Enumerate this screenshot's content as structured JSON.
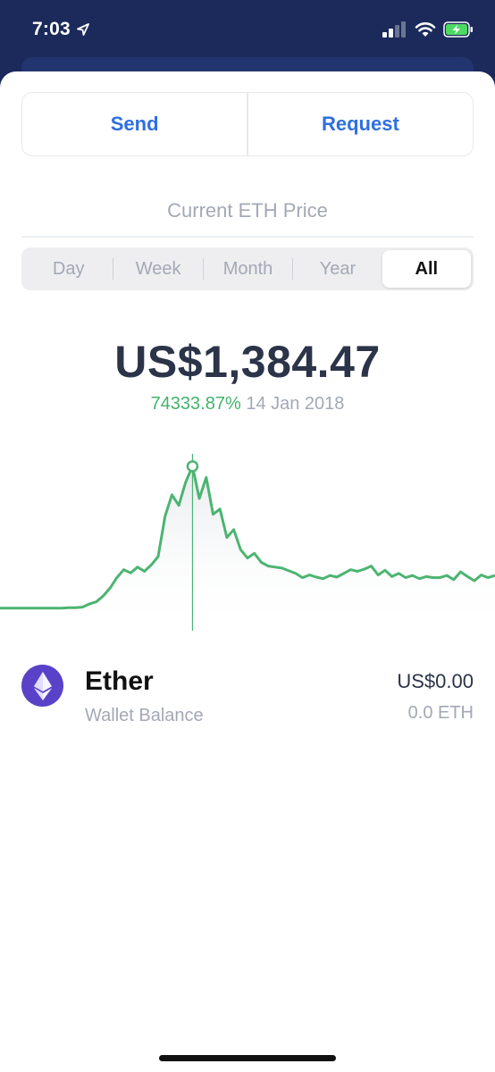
{
  "status_bar": {
    "time": "7:03",
    "icons": [
      "location-arrow-icon",
      "signal-icon",
      "wifi-icon",
      "battery-charging-icon"
    ]
  },
  "actions": {
    "send_label": "Send",
    "request_label": "Request"
  },
  "price_section": {
    "label": "Current ETH Price",
    "tabs": [
      "Day",
      "Week",
      "Month",
      "Year",
      "All"
    ],
    "active_tab": "All",
    "price": "US$1,384.47",
    "change_pct": "74333.87%",
    "date": "14 Jan 2018"
  },
  "chart_data": {
    "type": "line",
    "title": "",
    "xlabel": "",
    "ylabel": "",
    "series": [
      {
        "values": [
          2,
          2,
          2,
          2,
          2,
          2,
          2,
          2,
          2,
          2,
          3,
          3,
          4,
          10,
          14,
          25,
          40,
          60,
          75,
          69,
          80,
          72,
          84,
          100,
          176,
          217,
          197,
          241,
          271,
          210,
          250,
          180,
          190,
          136,
          151,
          113,
          97,
          106,
          89,
          82,
          80,
          78,
          73,
          68,
          60,
          65,
          61,
          58,
          64,
          61,
          68,
          75,
          72,
          76,
          82,
          65,
          74,
          62,
          68,
          60,
          64,
          58,
          62,
          60,
          60,
          64,
          56,
          71,
          62,
          54,
          65,
          60,
          64
        ]
      }
    ],
    "highlight": {
      "label": "14 Jan 2018",
      "value": "US$1,384.47"
    },
    "colors": {
      "line": "#4cb471",
      "fill": "#e9ecef"
    }
  },
  "asset": {
    "icon": "ethereum-icon",
    "name": "Ether",
    "subtitle": "Wallet Balance",
    "usd_value": "US$0.00",
    "eth_value": "0.0 ETH"
  },
  "colors": {
    "accent": "#2f6fdf",
    "positive": "#44b36b",
    "header_bg": "#1b2a5a",
    "eth_purple": "#5a42c8"
  }
}
